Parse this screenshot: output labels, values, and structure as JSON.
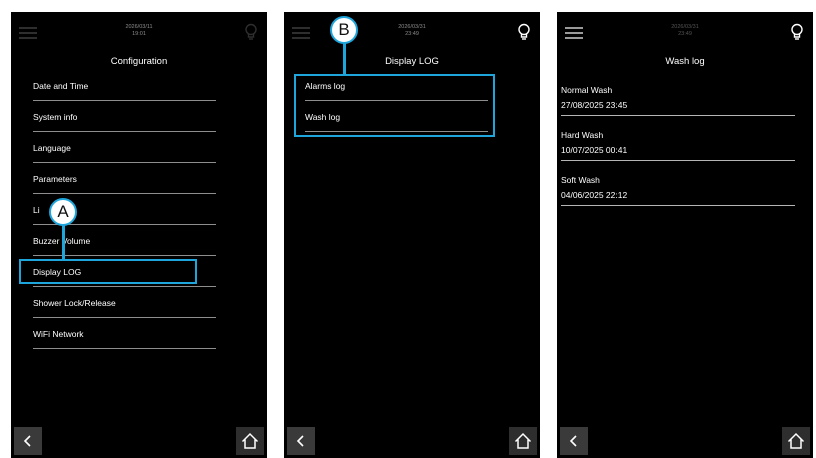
{
  "screens": {
    "configuration": {
      "date": "2026/03/11",
      "time": "19:01",
      "title": "Configuration",
      "items": [
        "Date and Time",
        "System info",
        "Language",
        "Parameters",
        "Li",
        "Buzzer Volume",
        "Display LOG",
        "Shower Lock/Release",
        "WiFi Network"
      ]
    },
    "display_log": {
      "date": "2026/03/31",
      "time": "23:49",
      "title": "Display LOG",
      "items": [
        "Alarms log",
        "Wash log"
      ]
    },
    "wash_log": {
      "date": "2026/03/31",
      "time": "23:49",
      "title": "Wash log",
      "entries": [
        {
          "type": "Normal Wash",
          "datetime": "27/08/2025 23:45"
        },
        {
          "type": "Hard Wash",
          "datetime": "10/07/2025 00:41"
        },
        {
          "type": "Soft Wash",
          "datetime": "04/06/2025 22:12"
        }
      ]
    }
  },
  "callouts": {
    "a": "A",
    "b": "B"
  },
  "colors": {
    "accent": "#1ea5db",
    "screen_bg": "#000000",
    "divider": "#8e8e8e"
  },
  "icons": {
    "menu": "hamburger-icon",
    "bulb": "lightbulb-icon",
    "back": "chevron-left-icon",
    "home": "home-icon"
  }
}
